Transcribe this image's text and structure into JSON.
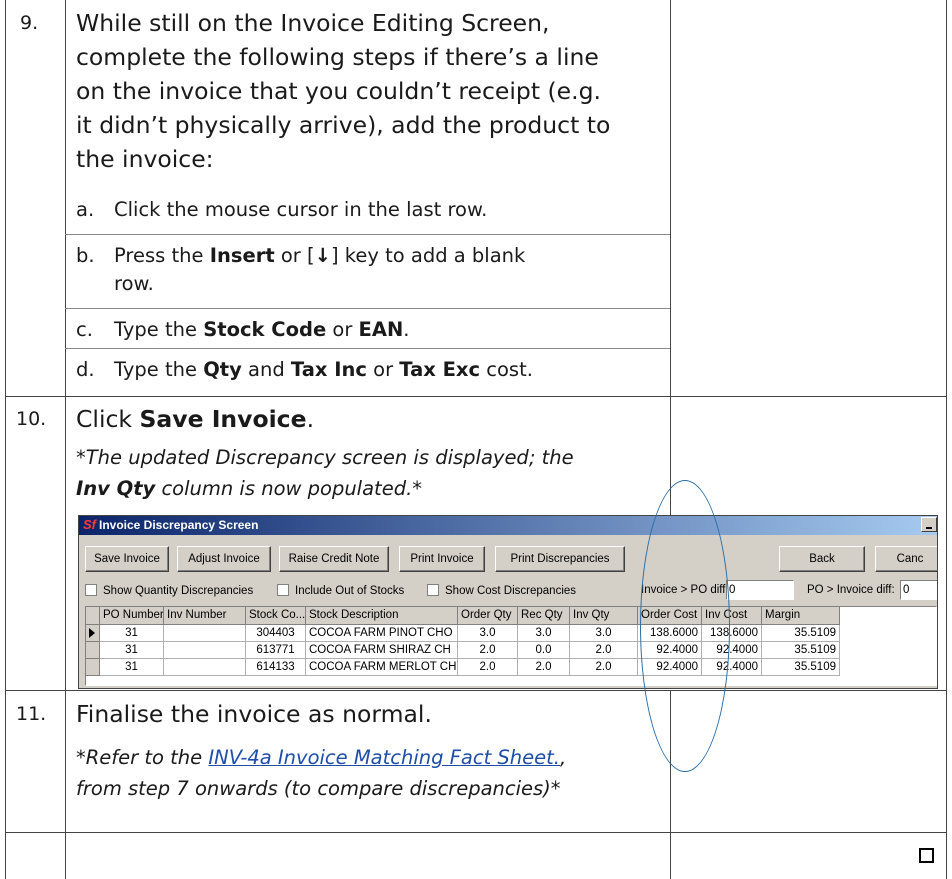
{
  "step9": {
    "number": "9.",
    "intro_lines": [
      "While still on the Invoice Editing Screen,",
      "complete the following steps if there’s a line",
      "on the invoice that you couldn’t receipt (e.g.",
      "it didn’t physically arrive), add the product to",
      "the invoice:"
    ],
    "a_letter": "a.",
    "a_text": "Click the mouse cursor in the last row.",
    "b_letter": "b.",
    "b_pre": "Press the ",
    "b_bold1": "Insert",
    "b_mid": " or [",
    "b_arrow": "↓",
    "b_post1": "] key to add a blank",
    "b_post2": "row.",
    "c_letter": "c.",
    "c_pre": "Type the ",
    "c_bold1": "Stock Code",
    "c_mid": " or ",
    "c_bold2": "EAN",
    "c_post": ".",
    "d_letter": "d.",
    "d_pre": "Type the ",
    "d_bold1": "Qty",
    "d_mid1": " and ",
    "d_bold2": "Tax Inc",
    "d_mid2": " or ",
    "d_bold3": "Tax Exc",
    "d_post": " cost."
  },
  "step10": {
    "number": "10.",
    "pre": "Click ",
    "bold": "Save Invoice",
    "post": ".",
    "note1": "*The updated Discrepancy screen is displayed; the",
    "note2_bold": "Inv Qty",
    "note2_rest": " column is now populated.*"
  },
  "screenshot": {
    "logo": "Sf",
    "title": "Invoice Discrepancy Screen",
    "buttons": [
      "Save Invoice",
      "Adjust Invoice",
      "Raise Credit Note",
      "Print Invoice",
      "Print Discrepancies",
      "Back",
      "Canc"
    ],
    "checkboxes": [
      "Show Quantity Discrepancies",
      "Include Out of Stocks",
      "Show Cost Discrepancies"
    ],
    "invoice_po_label": "Invoice > PO diff:",
    "invoice_po_value": "0",
    "po_invoice_label": "PO > Invoice diff:",
    "po_invoice_value": "0",
    "columns": [
      "PO Number",
      "Inv Number",
      "Stock Co...",
      "Stock Description",
      "Order Qty",
      "Rec Qty",
      "Inv Qty",
      "Order Cost",
      "Inv Cost",
      "Margin"
    ],
    "rows": [
      [
        "31",
        "",
        "304403",
        "COCOA FARM PINOT CHO",
        "3.0",
        "3.0",
        "3.0",
        "138.6000",
        "138.6000",
        "35.5109"
      ],
      [
        "31",
        "",
        "613771",
        "COCOA FARM SHIRAZ CH",
        "2.0",
        "0.0",
        "2.0",
        "92.4000",
        "92.4000",
        "35.5109"
      ],
      [
        "31",
        "",
        "614133",
        "COCOA FARM MERLOT CH",
        "2.0",
        "2.0",
        "2.0",
        "92.4000",
        "92.4000",
        "35.5109"
      ]
    ]
  },
  "step11": {
    "number": "11.",
    "text": "Finalise the invoice as normal.",
    "ref_pre": "*Refer to the ",
    "ref_link": "INV-4a Invoice Matching Fact Sheet.",
    "ref_post": ",",
    "ref_line2": "from step 7 onwards (to compare discrepancies)*"
  },
  "colors": {
    "link": "#1f4ea8",
    "oval": "#2b6fa8",
    "titlebar": "#0a246a"
  }
}
